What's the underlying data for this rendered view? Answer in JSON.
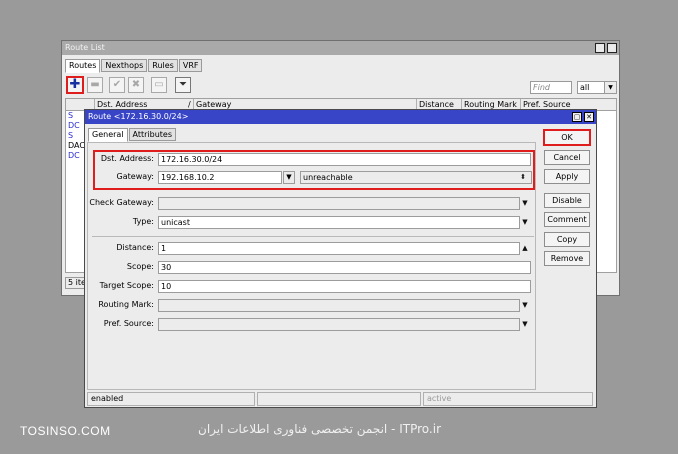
{
  "route_list": {
    "title": "Route List",
    "tabs": [
      "Routes",
      "Nexthops",
      "Rules",
      "VRF"
    ],
    "find_placeholder": "Find",
    "filter_value": "all",
    "columns": [
      "Dst. Address",
      "/",
      "Gateway",
      "Distance",
      "Routing Mark",
      "Pref. Source"
    ],
    "row_flags": [
      "S",
      "DC",
      "S",
      "DAC",
      "DC"
    ],
    "status_count": "5 items"
  },
  "dialog": {
    "title": "Route <172.16.30.0/24>",
    "tabs": [
      "General",
      "Attributes"
    ],
    "labels": {
      "dst_address": "Dst. Address:",
      "gateway": "Gateway:",
      "check_gateway": "Check Gateway:",
      "type": "Type:",
      "distance": "Distance:",
      "scope": "Scope:",
      "target_scope": "Target Scope:",
      "routing_mark": "Routing Mark:",
      "pref_source": "Pref. Source:"
    },
    "values": {
      "dst_address": "172.16.30.0/24",
      "gateway": "192.168.10.2",
      "gateway_state": "unreachable",
      "check_gateway": "",
      "type": "unicast",
      "distance": "1",
      "scope": "30",
      "target_scope": "10",
      "routing_mark": "",
      "pref_source": ""
    },
    "buttons": [
      "OK",
      "Cancel",
      "Apply",
      "Disable",
      "Comment",
      "Copy",
      "Remove"
    ],
    "status": {
      "left": "enabled",
      "right": "active"
    }
  },
  "watermark": {
    "left": "TOSINSO.COM",
    "right": "ITPro.ir - انجمن تخصصی فناوری اطلاعات ایران"
  },
  "colors": {
    "dialog_title": "#3745c6",
    "highlight": "#e01d1d",
    "flag_blue": "#2a2ad0"
  }
}
